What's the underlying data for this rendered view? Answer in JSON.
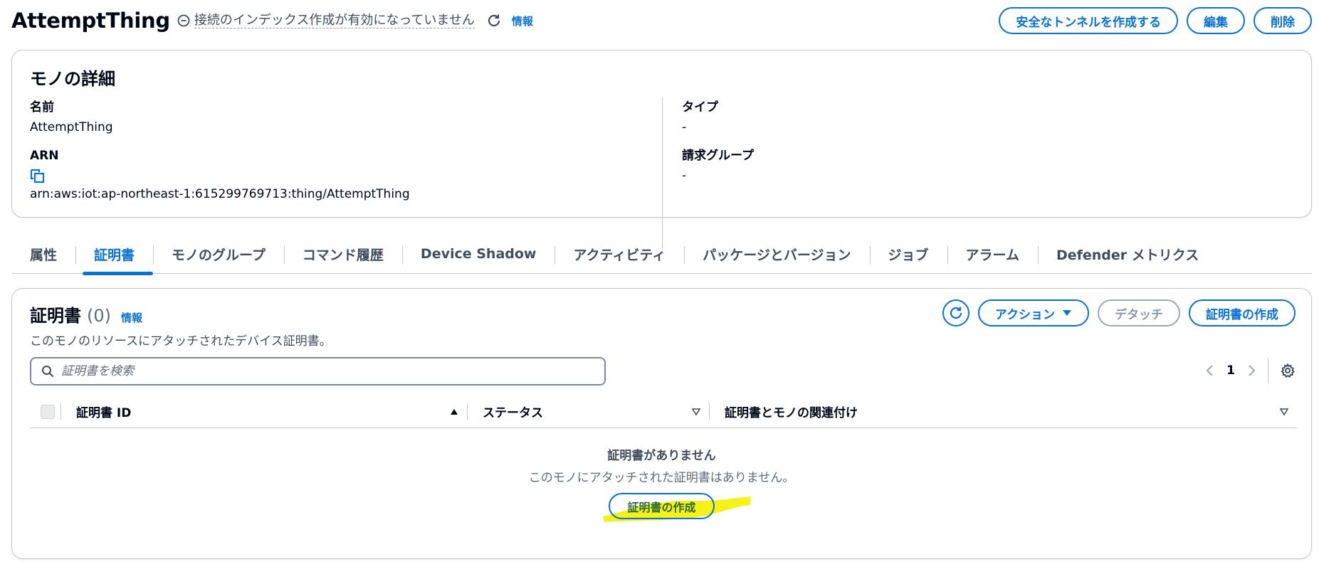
{
  "header": {
    "title": "AttemptThing",
    "index_status": "接続のインデックス作成が有効になっていません",
    "info_label": "情報",
    "actions": {
      "tunnel": "安全なトンネルを作成する",
      "edit": "編集",
      "delete": "削除"
    }
  },
  "details": {
    "title": "モノの詳細",
    "name_label": "名前",
    "name_value": "AttemptThing",
    "arn_label": "ARN",
    "arn_value": "arn:aws:iot:ap-northeast-1:615299769713:thing/AttemptThing",
    "type_label": "タイプ",
    "type_value": "-",
    "billing_label": "請求グループ",
    "billing_value": "-"
  },
  "tabs": [
    {
      "label": "属性"
    },
    {
      "label": "証明書"
    },
    {
      "label": "モノのグループ"
    },
    {
      "label": "コマンド履歴"
    },
    {
      "label": "Device Shadow"
    },
    {
      "label": "アクティビティ"
    },
    {
      "label": "パッケージとバージョン"
    },
    {
      "label": "ジョブ"
    },
    {
      "label": "アラーム"
    },
    {
      "label": "Defender メトリクス"
    }
  ],
  "active_tab": "証明書",
  "certificates": {
    "title": "証明書",
    "count": "(0)",
    "info_label": "情報",
    "description": "このモノのリソースにアタッチされたデバイス証明書。",
    "actions_label": "アクション",
    "detach_label": "デタッチ",
    "create_label": "証明書の作成",
    "search_placeholder": "証明書を検索",
    "page": "1",
    "columns": [
      "証明書 ID",
      "ステータス",
      "証明書とモノの関連付け"
    ],
    "empty_title": "証明書がありません",
    "empty_desc": "このモノにアタッチされた証明書はありません。",
    "empty_button": "証明書の作成"
  },
  "colors": {
    "accent": "#0972d3",
    "highlight": "#f5ef00"
  }
}
